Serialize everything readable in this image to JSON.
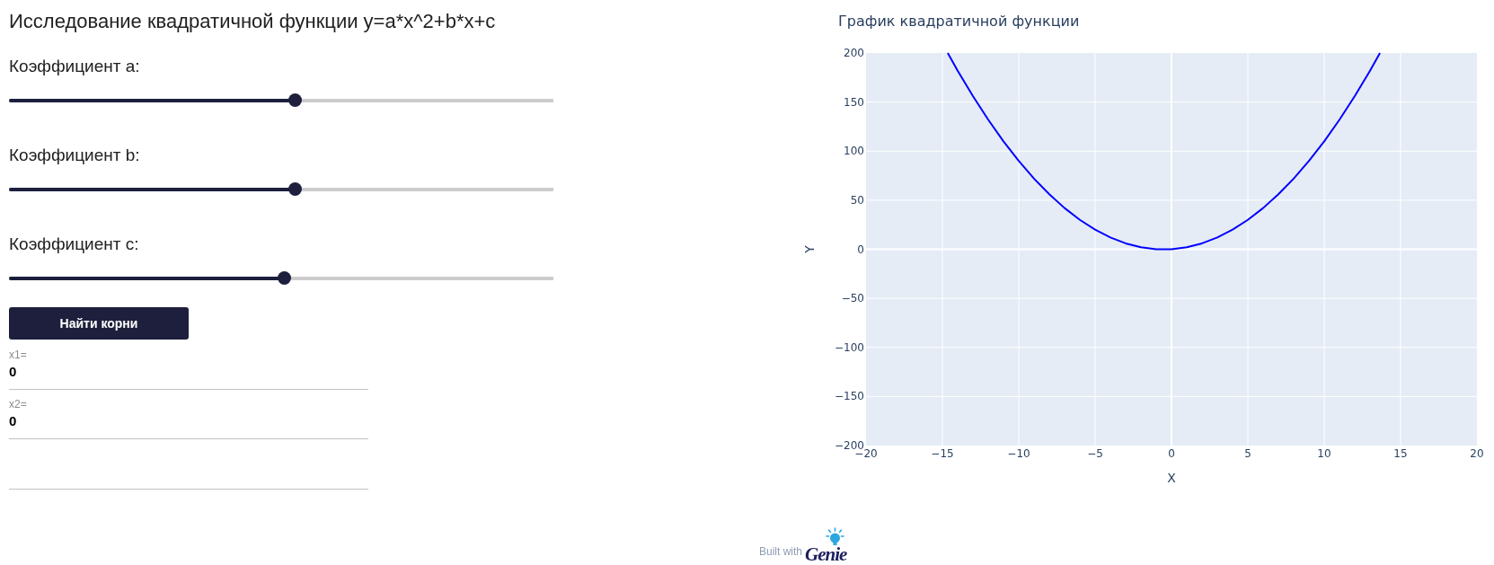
{
  "title": "Исследование квадратичной функции y=a*x^2+b*x+c",
  "sliders": [
    {
      "label": "Коэффициент a:",
      "level": 0.526
    },
    {
      "label": "Коэффициент b:",
      "level": 0.526
    },
    {
      "label": "Коэффициент c:",
      "level": 0.505
    }
  ],
  "button": {
    "label": "Найти корни"
  },
  "fields": [
    {
      "kind": "result",
      "label": "x1=",
      "value": "0"
    },
    {
      "kind": "result",
      "label": "x2=",
      "value": "0"
    },
    {
      "kind": "blank"
    }
  ],
  "chart": {
    "chart_data": {
      "type": "line",
      "title": "График квадратичной функции",
      "xlabel": "X",
      "ylabel": "Y",
      "grid": true,
      "x": [
        -14.65,
        -14,
        -13,
        -12,
        -11,
        -10,
        -9,
        -8,
        -7,
        -6,
        -5,
        -4,
        -3,
        -2,
        -1,
        0,
        1,
        2,
        3,
        4,
        5,
        6,
        7,
        8,
        9,
        10,
        11,
        12,
        13,
        13.65
      ],
      "series": [
        {
          "color": "#0000ff",
          "values": [
            200,
            182,
            156,
            132,
            110,
            90,
            72,
            56,
            42,
            30,
            20,
            12,
            6,
            2,
            0,
            0,
            2,
            6,
            12,
            20,
            30,
            42,
            56,
            72,
            90,
            110,
            132,
            156,
            182,
            200
          ]
        }
      ],
      "xlim": [
        -20,
        20
      ],
      "ylim": [
        -200,
        200
      ],
      "xticks": [
        {
          "value": -20,
          "label": "−20"
        },
        {
          "value": -15,
          "label": "−15"
        },
        {
          "value": -10,
          "label": "−10"
        },
        {
          "value": -5,
          "label": "−5"
        },
        0,
        5,
        10,
        15,
        20
      ],
      "yticks": [
        {
          "value": -200,
          "label": "−200"
        },
        {
          "value": -150,
          "label": "−150"
        },
        {
          "value": -100,
          "label": "−100"
        },
        {
          "value": -50,
          "label": "−50"
        },
        0,
        50,
        100,
        150,
        200
      ]
    }
  },
  "footer": {
    "text": "Built with",
    "logo": "Genie"
  }
}
